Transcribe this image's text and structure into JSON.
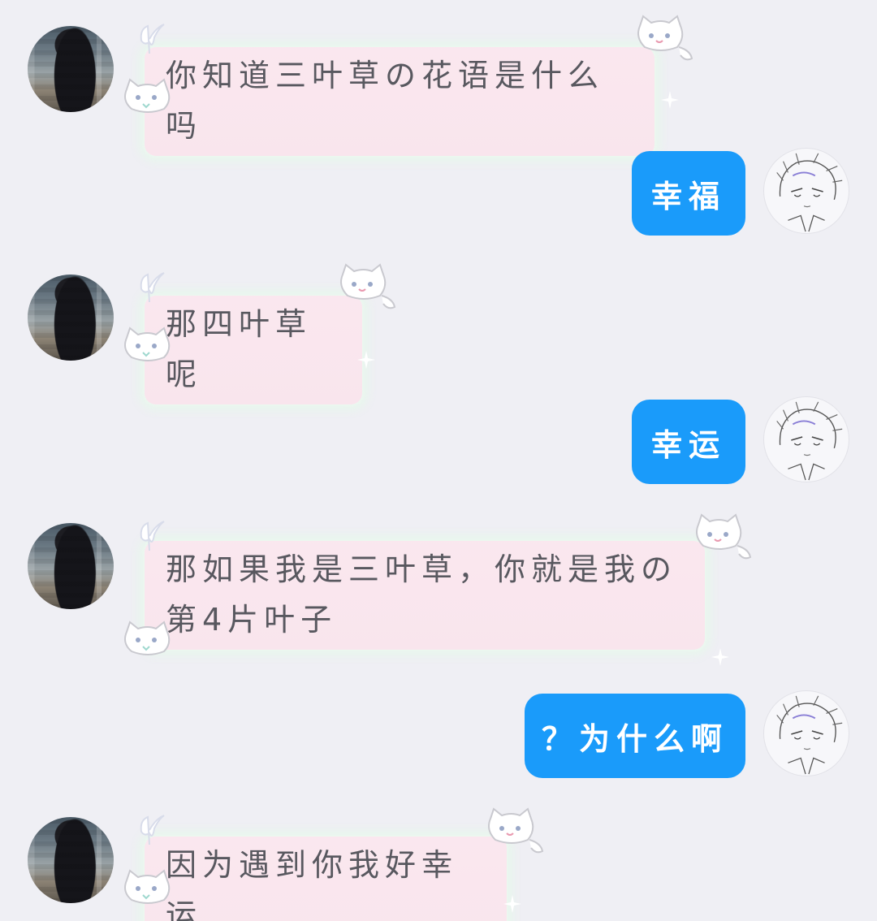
{
  "messages": [
    {
      "side": "in",
      "text": "你知道三叶草の花语是什么吗"
    },
    {
      "side": "out",
      "text": "幸福"
    },
    {
      "side": "in",
      "text": "那四叶草呢"
    },
    {
      "side": "out",
      "text": "幸运"
    },
    {
      "side": "in",
      "text": "那如果我是三叶草，你就是我の第4片叶子"
    },
    {
      "side": "out",
      "text": "？为什么啊"
    },
    {
      "side": "in",
      "text": "因为遇到你我好幸运"
    }
  ],
  "icons": {
    "incoming_avatar": "avatar-photo-long-black-hair",
    "outgoing_avatar": "avatar-anime-sketch",
    "bubble_decor": [
      "cat-sticker-icon",
      "butterfly-icon",
      "sparkle-icon"
    ]
  },
  "colors": {
    "background": "#efeff4",
    "outgoing_bubble": "#1a9bfa",
    "incoming_bubble": "#fbe5ed",
    "incoming_text": "#58585f"
  }
}
